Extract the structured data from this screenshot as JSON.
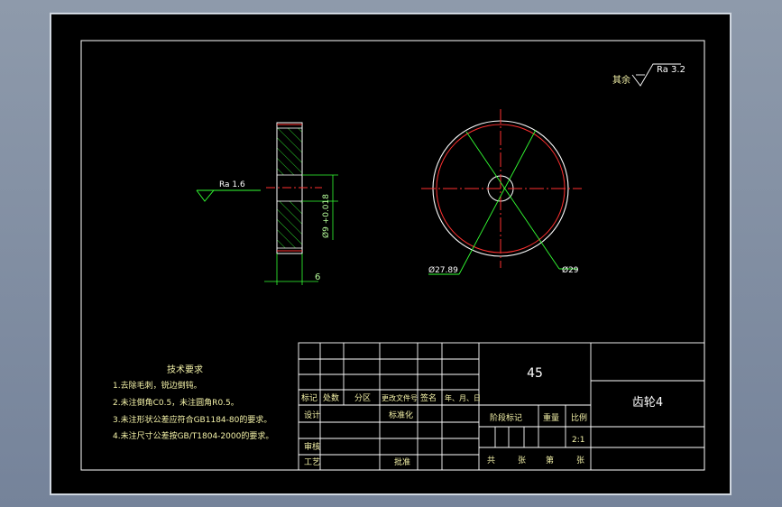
{
  "colors": {
    "frame": "#ffffff",
    "centerline": "#ff3030",
    "dimension": "#33ff33",
    "text": "#f4f2a8",
    "background": "#000000"
  },
  "roughness": {
    "other_prefix": "其余",
    "other_value": "Ra 3.2",
    "face_value": "Ra 1.6"
  },
  "dimensions": {
    "bore": "Ø9 +0.018",
    "width": "6",
    "outer_dia": "Ø29",
    "pitch_dia": "Ø27.89"
  },
  "tech_requirements": {
    "title": "技术要求",
    "items": [
      "1.去除毛刺，锐边倒钝。",
      "2.未注倒角C0.5，未注圆角R0.5。",
      "3.未注形状公差应符合GB1184-80的要求。",
      "4.未注尺寸公差按GB/T1804-2000的要求。"
    ]
  },
  "title_block": {
    "material": "45",
    "part_name": "齿轮4",
    "labels": {
      "mark": "标记",
      "count": "处数",
      "zone": "分区",
      "doc_no": "更改文件号",
      "sign": "签名",
      "date": "年、月、日",
      "design": "设计",
      "standardize": "标准化",
      "review": "审核",
      "process": "工艺",
      "approve": "批准",
      "stage_mark": "阶段标记",
      "weight": "重量",
      "scale": "比例",
      "scale_value": "2:1",
      "total": "共",
      "sheets": "张",
      "sheet_no": "第",
      "sheet": "张"
    }
  }
}
